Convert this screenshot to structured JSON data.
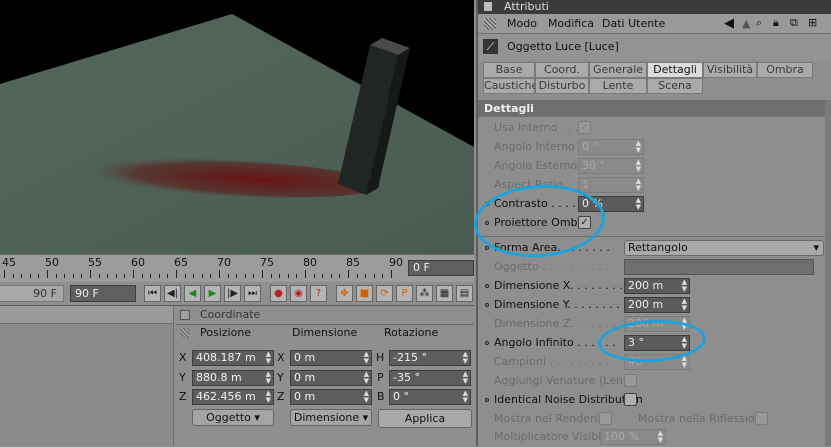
{
  "timeline": {
    "ticks": [
      "45",
      "50",
      "55",
      "60",
      "65",
      "70",
      "75",
      "80",
      "85",
      "90"
    ],
    "current_frame": "0 F",
    "range_end_left": "90 F",
    "range_end_right": "90 F"
  },
  "coord_manager": {
    "header": "Coordinate",
    "col_position": "Posizione",
    "col_dimension": "Dimensione",
    "col_rotation": "Rotazione",
    "pos_labels": [
      "X",
      "Y",
      "Z"
    ],
    "dim_labels": [
      "X",
      "Y",
      "Z"
    ],
    "rot_labels": [
      "H",
      "P",
      "B"
    ],
    "positions": [
      "408.187 m",
      "880.8 m",
      "462.456 m"
    ],
    "dimensions": [
      "0 m",
      "0 m",
      "0 m"
    ],
    "rotations": [
      "-215 °",
      "-35 °",
      "0 °"
    ],
    "dropdown_object": "Oggetto",
    "dropdown_dimension": "Dimensione",
    "apply_label": "Applica"
  },
  "attributes": {
    "window_title": "Attributi",
    "menu": [
      "Modo",
      "Modifica",
      "Dati Utente"
    ],
    "object_name": "Oggetto Luce [Luce]",
    "tabs_row1": [
      "Base",
      "Coord.",
      "Generale",
      "Dettagli",
      "Visibilità",
      "Ombra"
    ],
    "tabs_row2": [
      "Caustiche",
      "Disturbo",
      "Lente",
      "Scena"
    ],
    "active_tab": "Dettagli",
    "section_title": "Dettagli",
    "params": {
      "usa_interno": "Usa Interno . . .",
      "angolo_interno": "Angolo Interno",
      "angolo_interno_val": "0 °",
      "angolo_esterno": "Angolo Esterno",
      "angolo_esterno_val": "30 °",
      "aspect_ratio": "Aspect Ratio",
      "aspect_ratio_val": "1",
      "contrasto": "Contrasto . . . . .",
      "contrasto_val": "0 %",
      "proiettore_ombre": "Proiettore Ombre",
      "forma_area": "Forma Area. . . . . . . .",
      "forma_area_val": "Rettangolo",
      "oggetto": "Oggetto . . . . . . . . . .",
      "dimensione_x": "Dimensione X. . . . . . . .",
      "dimensione_x_val": "200 m",
      "dimensione_y": "Dimensione Y. . . . . . . .",
      "dimensione_y_val": "200 m",
      "dimensione_z": "Dimensione Z. . . . . . . .",
      "dimensione_z_val": "200 m",
      "angolo_infinito": "Angolo Infinito . . . . . .",
      "angolo_infinito_val": "3 °",
      "campioni": "Campioni . . . . . . . . .",
      "campioni_val": "40",
      "aggiungi_venature": "Aggiungi Venature (Lento)",
      "identical_noise": "Identical Noise Distribution",
      "mostra_rendering": "Mostra nel Rendering",
      "mostra_riflessione": "Mostra nella Riflessione",
      "moltiplicatore": "Moltiplicatore Visibilità",
      "moltiplicatore_val": "100 %"
    }
  },
  "colors": {
    "annotation": "#1aa3dc",
    "floor": "#4d5f55",
    "shadow": "#5c1414"
  }
}
